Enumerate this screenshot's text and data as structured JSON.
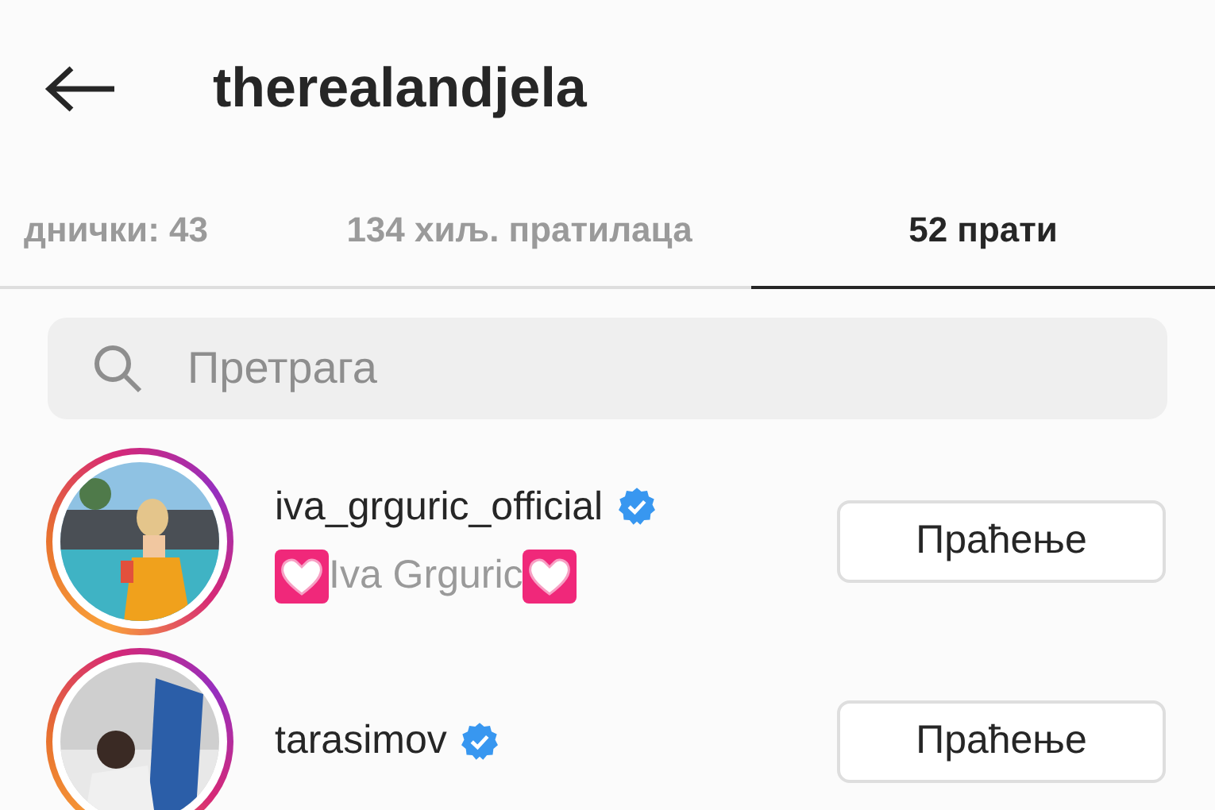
{
  "header": {
    "title": "therealandjela"
  },
  "tabs": [
    {
      "label": "днички: 43",
      "selected": false
    },
    {
      "label": "134 хиљ. пратилаца",
      "selected": false
    },
    {
      "label": "52 прати",
      "selected": true
    }
  ],
  "search": {
    "placeholder": "Претрага"
  },
  "accounts": [
    {
      "username": "iva_grguric_official",
      "verified": true,
      "full_name": "Iva Grguric",
      "hearts": true,
      "button": "Праћење"
    },
    {
      "username": "tarasimov",
      "verified": true,
      "button": "Праћење"
    }
  ]
}
